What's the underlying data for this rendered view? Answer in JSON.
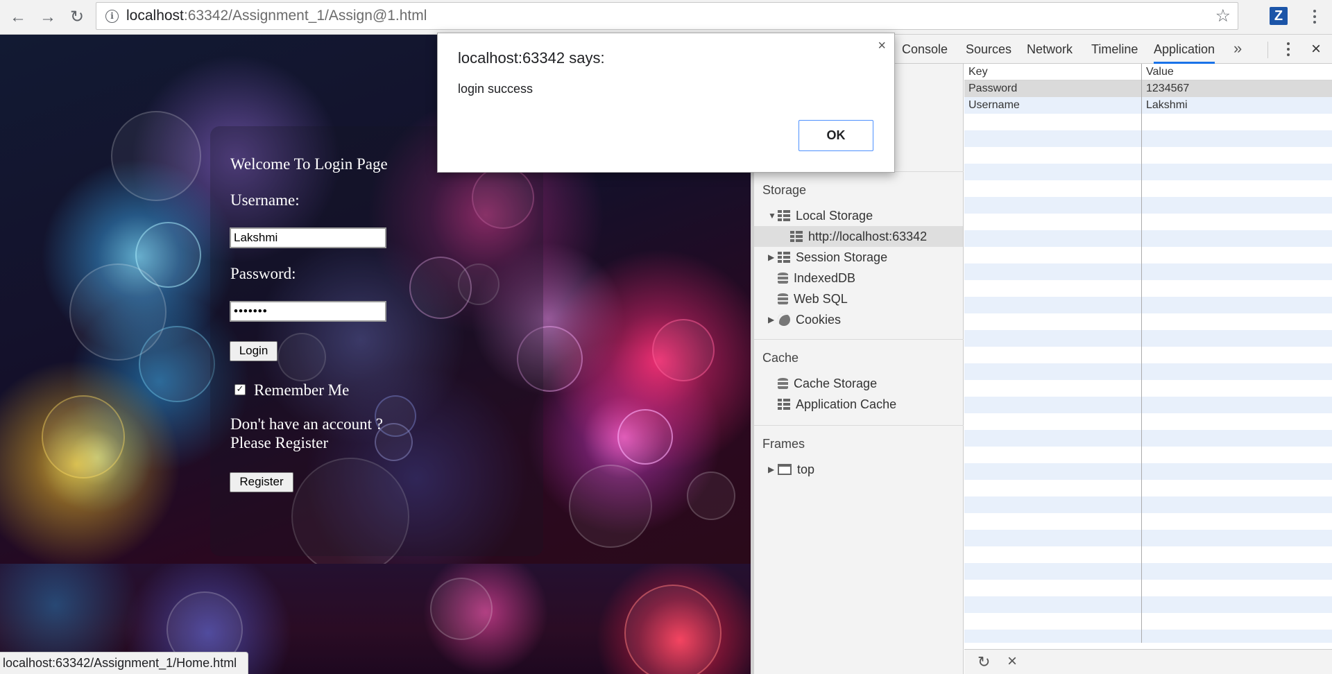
{
  "browser": {
    "url_host": "localhost",
    "url_rest": ":63342/Assignment_1/Assign@1.html",
    "back_icon": "←",
    "forward_icon": "→",
    "reload_icon": "↻",
    "info_icon": "i",
    "star_icon": "☆",
    "extension_label": "Z",
    "status_url": "localhost:63342/Assignment_1/Home.html"
  },
  "page": {
    "title": "Welcome To Login Page",
    "username_label": "Username:",
    "username_value": "Lakshmi",
    "password_label": "Password:",
    "password_value": "•••••••",
    "login_button": "Login",
    "remember_checked": true,
    "remember_check_glyph": "✓",
    "remember_label": "Remember Me",
    "no_account_line1": "Don't have an account ?",
    "no_account_line2": "Please Register",
    "register_button": "Register"
  },
  "dialog": {
    "title": "localhost:63342 says:",
    "message": "login success",
    "ok_label": "OK",
    "close_icon": "×"
  },
  "devtools": {
    "tabs": [
      {
        "label": "Console"
      },
      {
        "label": "Sources"
      },
      {
        "label": "Network"
      },
      {
        "label": "Timeline"
      },
      {
        "label": "Application",
        "active": true
      }
    ],
    "more_tabs_icon": "»",
    "close_icon": "×",
    "sidebar": {
      "storage_header": "Storage",
      "local_storage": "Local Storage",
      "local_storage_origin": "http://localhost:63342",
      "session_storage": "Session Storage",
      "indexeddb": "IndexedDB",
      "websql": "Web SQL",
      "cookies": "Cookies",
      "cache_header": "Cache",
      "cache_storage": "Cache Storage",
      "application_cache": "Application Cache",
      "frames_header": "Frames",
      "frame_top": "top",
      "expanded_glyph": "▼",
      "collapsed_glyph": "▶"
    },
    "table": {
      "col_key": "Key",
      "col_value": "Value",
      "rows": [
        {
          "key": "Password",
          "value": "1234567",
          "selected": true
        },
        {
          "key": "Username",
          "value": "Lakshmi"
        }
      ]
    },
    "footer": {
      "refresh_icon": "↻",
      "clear_icon": "×"
    }
  },
  "colors": {
    "accent": "#1a73e8",
    "dialog_ok_border": "#4d90fe",
    "extension_bg": "#1c55a8"
  }
}
